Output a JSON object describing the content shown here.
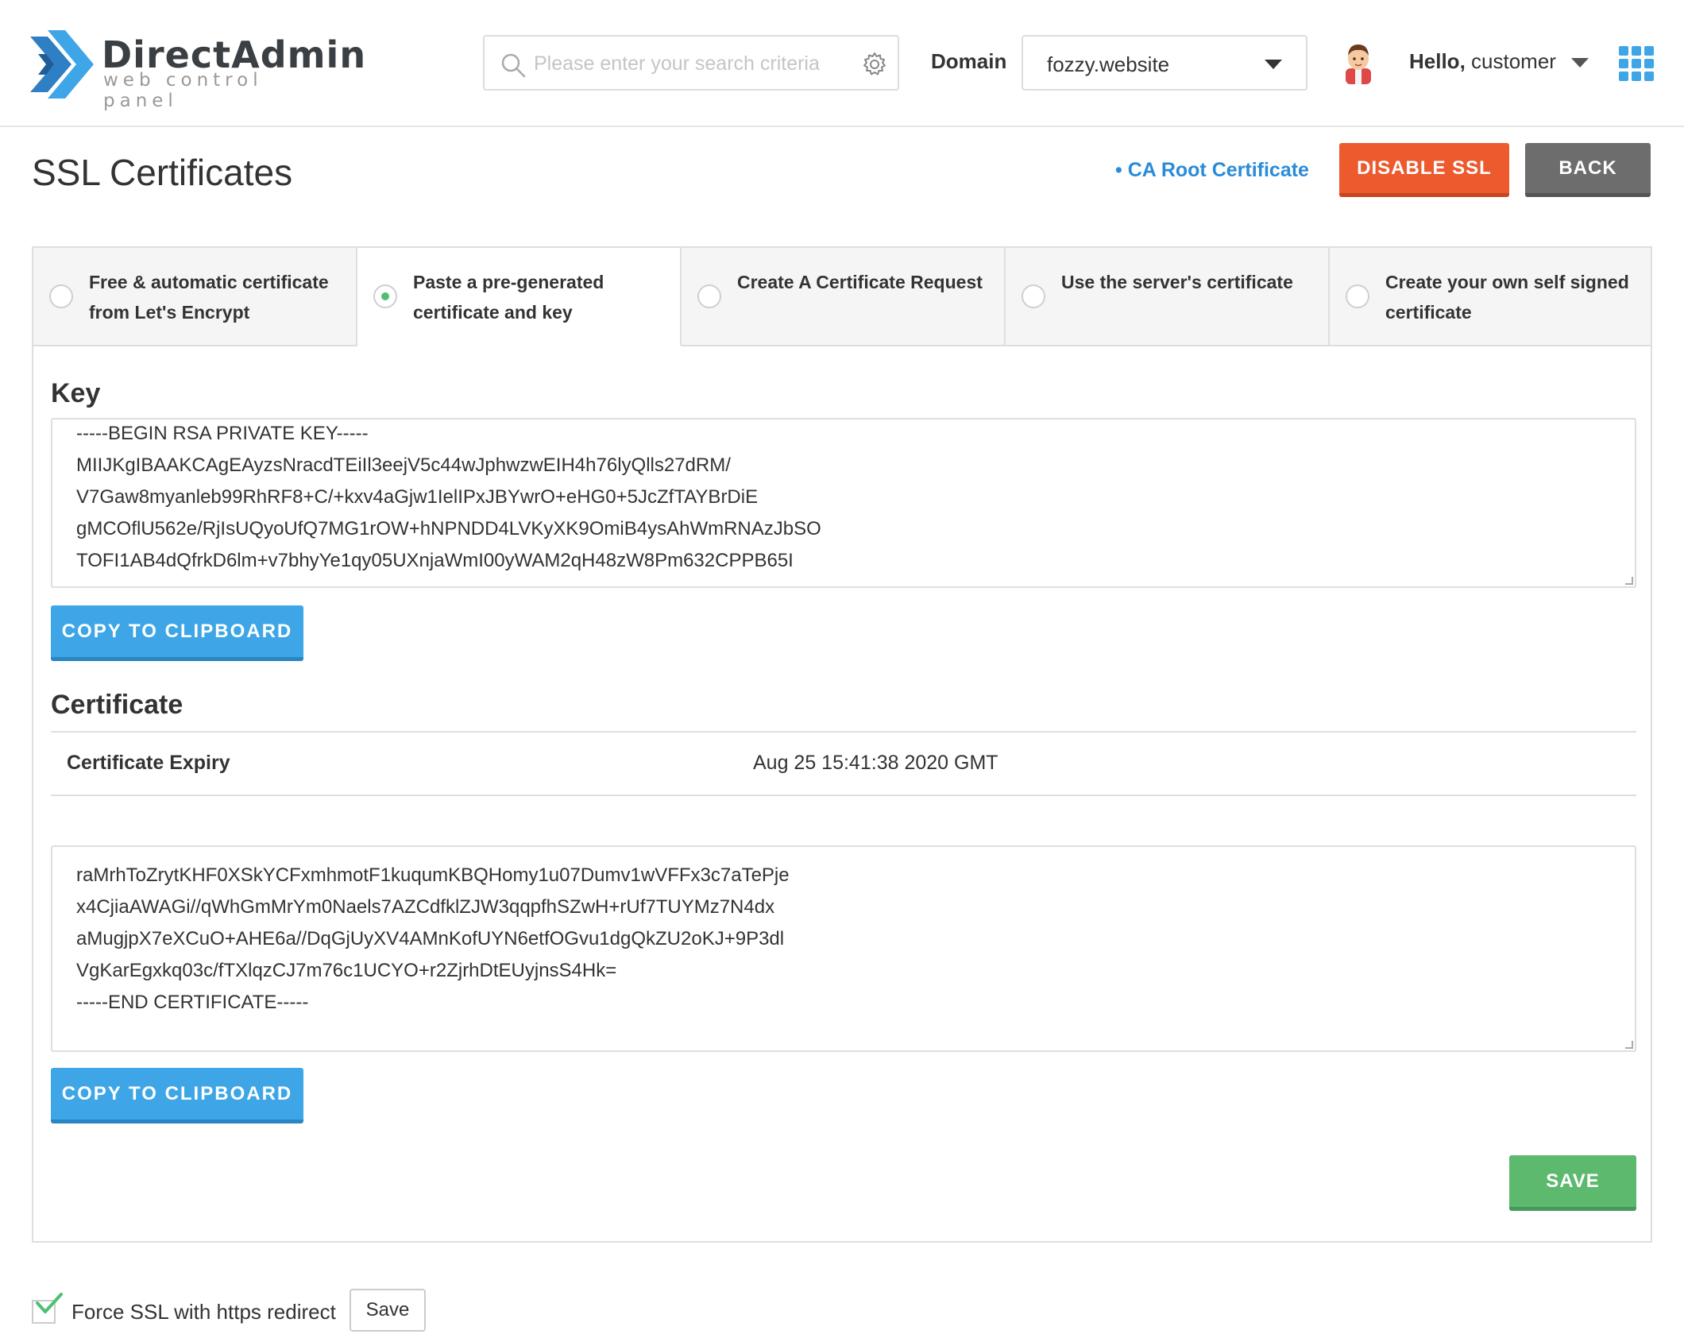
{
  "header": {
    "logo_name": "DirectAdmin",
    "logo_sub": "web control panel",
    "search_placeholder": "Please enter your search criteria",
    "domain_label": "Domain",
    "domain_value": "fozzy.website",
    "greeting_prefix": "Hello,",
    "greeting_user": "customer"
  },
  "page": {
    "title": "SSL Certificates",
    "ca_link": "• CA Root Certificate",
    "disable_ssl": "DISABLE SSL",
    "back": "BACK"
  },
  "tabs": [
    {
      "label": "Free & automatic certificate from Let's Encrypt",
      "selected": false
    },
    {
      "label": "Paste a pre-generated certificate and key",
      "selected": true
    },
    {
      "label": "Create A Certificate Request",
      "selected": false
    },
    {
      "label": "Use the server's certificate",
      "selected": false
    },
    {
      "label": "Create your own self signed certificate",
      "selected": false
    }
  ],
  "key_section": {
    "title": "Key",
    "lines": [
      "-----BEGIN RSA PRIVATE KEY-----",
      "MIIJKgIBAAKCAgEAyzsNracdTEiIl3eejV5c44wJphwzwEIH4h76lyQlls27dRM/",
      "V7Gaw8myanleb99RhRF8+C/+kxv4aGjw1IelIPxJBYwrO+eHG0+5JcZfTAYBrDiE",
      "gMCOflU562e/RjIsUQyoUfQ7MG1rOW+hNPNDD4LVKyXK9OmiB4ysAhWmRNAzJbSO",
      "TOFI1AB4dQfrkD6lm+v7bhyYe1qy05UXnjaWmI00yWAM2qH48zW8Pm632CPPB65I"
    ],
    "copy_button": "COPY TO CLIPBOARD"
  },
  "certificate_section": {
    "title": "Certificate",
    "expiry_label": "Certificate Expiry",
    "expiry_value": "Aug 25 15:41:38 2020 GMT",
    "lines": [
      "raMrhToZrytKHF0XSkYCFxmhmotF1kuqumKBQHomy1u07Dumv1wVFFx3c7aTePje",
      "x4CjiaAWAGi//qWhGmMrYm0Naels7AZCdfklZJW3qqpfhSZwH+rUf7TUYMz7N4dx",
      "aMugjpX7eXCuO+AHE6a//DqGjUyXV4AMnKofUYN6etfOGvu1dgQkZU2oKJ+9P3dl",
      "VgKarEgxkq03c/fTXlqzCJ7m76c1UCYO+r2ZjrhDtEUyjnsS4Hk=",
      "-----END CERTIFICATE-----"
    ],
    "copy_button": "COPY TO CLIPBOARD"
  },
  "save_button": "SAVE",
  "force_ssl": {
    "label": "Force SSL with https redirect",
    "checked": true,
    "save_button": "Save"
  },
  "colors": {
    "accent_blue": "#3ea6e6",
    "link_blue": "#2a8bd8",
    "danger": "#ec5a2e",
    "success": "#5cb96e",
    "neutral": "#6d6d6d"
  }
}
